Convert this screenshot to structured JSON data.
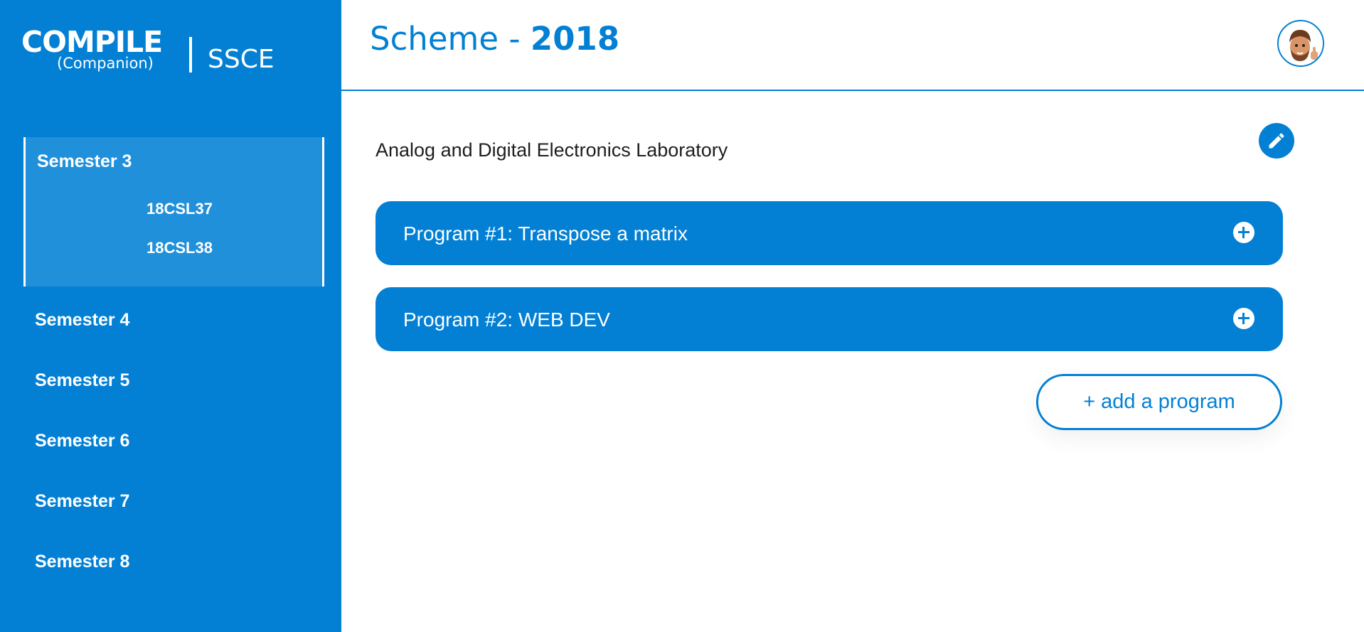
{
  "brand": {
    "name": "COMPILE",
    "sub": "(Companion)",
    "org": "SSCE"
  },
  "sidebar": {
    "active": {
      "label": "Semester 3",
      "courses": [
        "18CSL37",
        "18CSL38"
      ]
    },
    "items": [
      {
        "label": "Semester 4"
      },
      {
        "label": "Semester 5"
      },
      {
        "label": "Semester 6"
      },
      {
        "label": "Semester 7"
      },
      {
        "label": "Semester 8"
      }
    ]
  },
  "header": {
    "title_prefix": "Scheme - ",
    "year": "2018"
  },
  "main": {
    "lab_title": "Analog and Digital Electronics Laboratory",
    "programs": [
      {
        "title": "Program #1: Transpose a matrix"
      },
      {
        "title": "Program #2: WEB DEV"
      }
    ],
    "add_label": "+ add a program"
  },
  "colors": {
    "primary": "#0380d4",
    "active_item": "#2190da"
  },
  "icons": {
    "edit": "pencil-icon",
    "expand": "plus-circle-icon",
    "avatar": "avatar-memoji"
  }
}
